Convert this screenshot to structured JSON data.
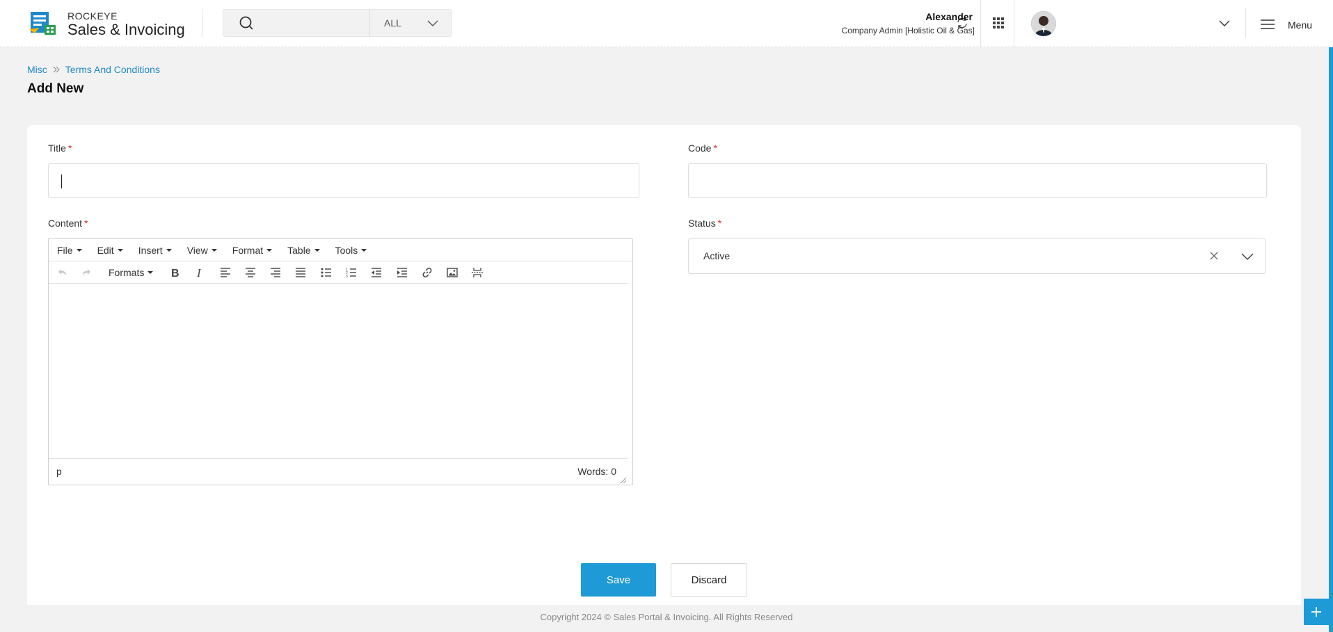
{
  "header": {
    "brand_top": "ROCKEYE",
    "brand_main": "Sales & Invoicing",
    "search": {
      "placeholder": "",
      "scope": "ALL"
    },
    "user": {
      "name": "Alexander",
      "role": "Company Admin [Holistic Oil & Gas]"
    },
    "menu_label": "Menu"
  },
  "breadcrumb": {
    "items": [
      "Misc",
      "Terms And Conditions"
    ]
  },
  "page_title": "Add New",
  "form": {
    "title": {
      "label": "Title",
      "value": ""
    },
    "code": {
      "label": "Code",
      "value": ""
    },
    "content": {
      "label": "Content",
      "menus": [
        "File",
        "Edit",
        "Insert",
        "View",
        "Format",
        "Table",
        "Tools"
      ],
      "formats_label": "Formats",
      "path": "p",
      "word_count": "Words: 0"
    },
    "status": {
      "label": "Status",
      "value": "Active"
    },
    "required_mark": "*",
    "save_label": "Save",
    "discard_label": "Discard"
  },
  "footer": {
    "copyright": "Copyright 2024 © Sales Portal & Invoicing. All Rights Reserved"
  },
  "colors": {
    "accent": "#1e9ad6",
    "link": "#1e88c9",
    "required": "#d32f2f"
  }
}
